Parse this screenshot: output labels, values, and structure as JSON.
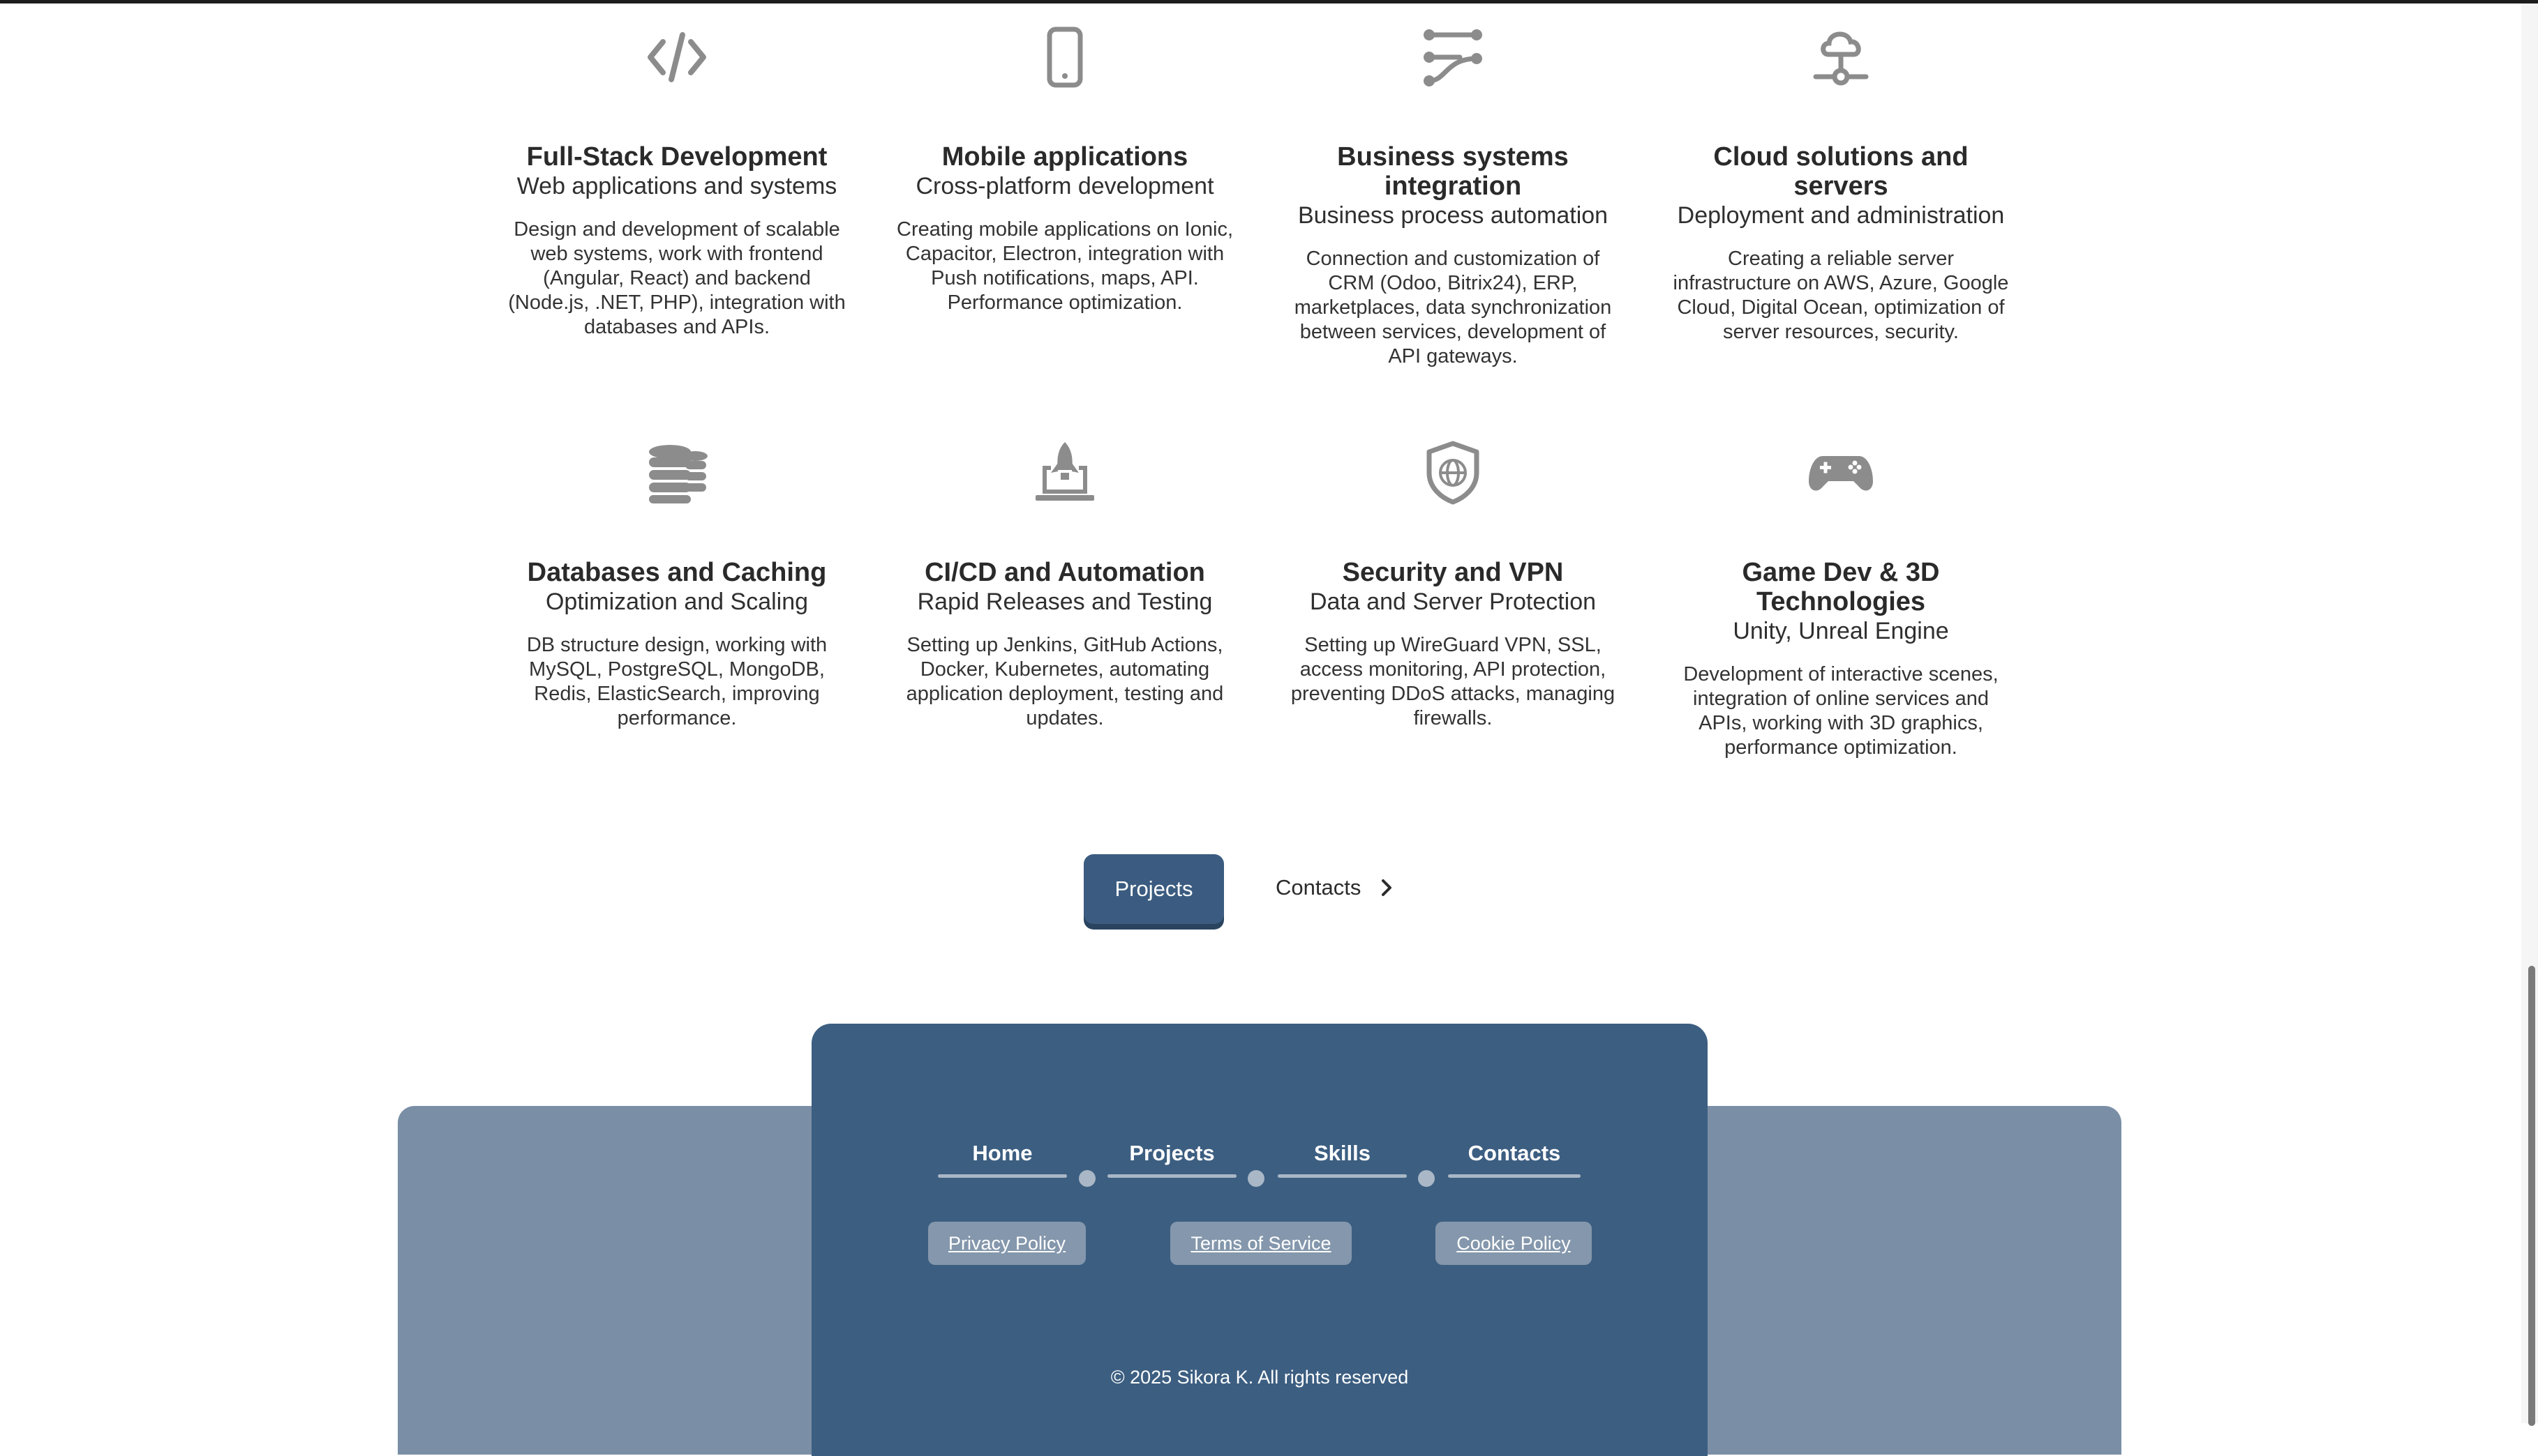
{
  "services": [
    {
      "icon": "code-icon",
      "title": "Full-Stack Development",
      "subtitle": "Web applications and systems",
      "description": "Design and development of scalable web systems, work with frontend (Angular, React) and backend (Node.js, .NET, PHP), integration with databases and APIs."
    },
    {
      "icon": "smartphone-icon",
      "title": "Mobile applications",
      "subtitle": "Cross-platform development",
      "description": "Creating mobile applications on Ionic, Capacitor, Electron, integration with Push notifications, maps, API. Performance optimization."
    },
    {
      "icon": "route-icon",
      "title": "Business systems integration",
      "subtitle": "Business process automation",
      "description": "Connection and customization of CRM (Odoo, Bitrix24), ERP, marketplaces, data synchronization between services, development of API gateways."
    },
    {
      "icon": "cloud-network-icon",
      "title": "Cloud solutions and servers",
      "subtitle": "Deployment and administration",
      "description": "Creating a reliable server infrastructure on AWS, Azure, Google Cloud, Digital Ocean, optimization of server resources, security."
    },
    {
      "icon": "database-coins-icon",
      "title": "Databases and Caching",
      "subtitle": "Optimization and Scaling",
      "description": "DB structure design, working with MySQL, PostgreSQL, MongoDB, Redis, ElasticSearch, improving performance."
    },
    {
      "icon": "laptop-rocket-icon",
      "title": "CI/CD and Automation",
      "subtitle": "Rapid Releases and Testing",
      "description": "Setting up Jenkins, GitHub Actions, Docker, Kubernetes, automating application deployment, testing and updates."
    },
    {
      "icon": "shield-globe-icon",
      "title": "Security and VPN",
      "subtitle": "Data and Server Protection",
      "description": "Setting up WireGuard VPN, SSL, access monitoring, API protection, preventing DDoS attacks, managing firewalls."
    },
    {
      "icon": "gamepad-icon",
      "title": "Game Dev & 3D Technologies",
      "subtitle": "Unity, Unreal Engine",
      "description": "Development of interactive scenes, integration of online services and APIs, working with 3D graphics, performance optimization."
    }
  ],
  "page_nav": {
    "projects_label": "Projects",
    "contacts_label": "Contacts"
  },
  "footer": {
    "nav": [
      "Home",
      "Projects",
      "Skills",
      "Contacts"
    ],
    "policies": [
      "Privacy Policy",
      "Terms of Service",
      "Cookie Policy"
    ],
    "copyright": "© 2025 Sikora K. All rights reserved"
  },
  "colors": {
    "accent": "#3b5c80",
    "footer_back": "#7a8fa6",
    "footer_front": "#3c5e81",
    "icon_gray": "#8c8c8c"
  }
}
